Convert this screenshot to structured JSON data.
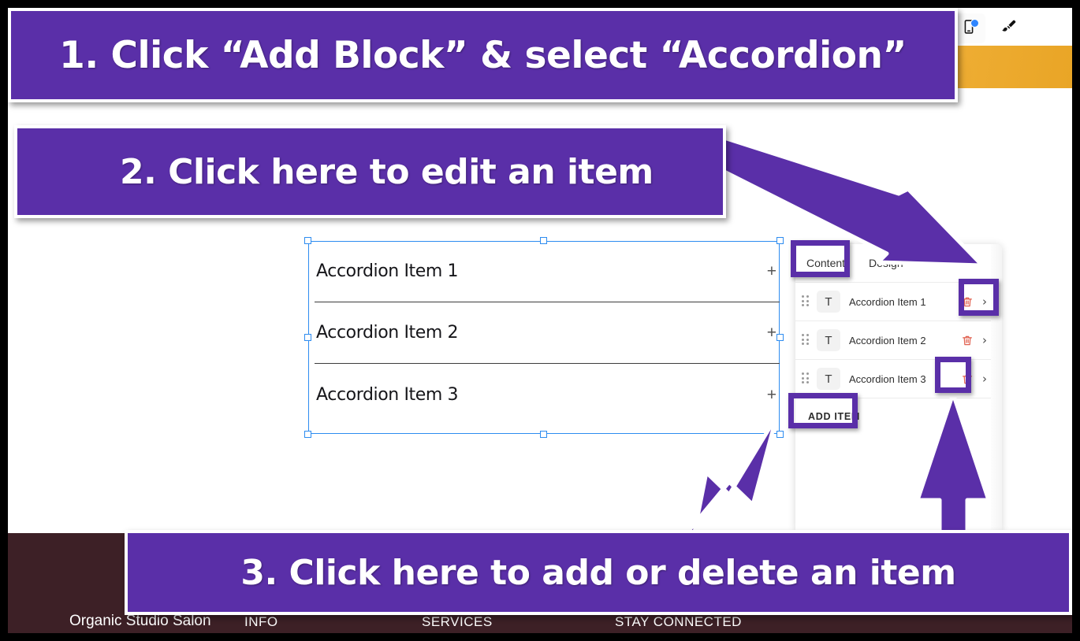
{
  "callouts": [
    {
      "id": "callout-1",
      "text": "1. Click “Add Block” & select “Accordion”"
    },
    {
      "id": "callout-2",
      "text": "2. Click here to edit an item"
    },
    {
      "id": "callout-3",
      "text": "3. Click here to add or delete an item"
    }
  ],
  "toolbar": {
    "desktop_icon": "desktop-monitor-icon",
    "mobile_icon": "mobile-phone-icon",
    "brush_icon": "paint-brush-icon",
    "mobile_badge": "new-indicator-dot"
  },
  "canvas": {
    "accordion_items": [
      {
        "title": "Accordion Item 1",
        "toggle": "+"
      },
      {
        "title": "Accordion Item 2",
        "toggle": "+"
      },
      {
        "title": "Accordion Item 3",
        "toggle": "+"
      }
    ]
  },
  "panel": {
    "tabs": [
      {
        "label": "Content",
        "active": true
      },
      {
        "label": "Design",
        "active": false
      }
    ],
    "rows": [
      {
        "type_icon": "T",
        "label": "Accordion Item 1"
      },
      {
        "type_icon": "T",
        "label": "Accordion Item 2"
      },
      {
        "type_icon": "T",
        "label": "Accordion Item 3"
      }
    ],
    "add_item_label": "ADD ITEM"
  },
  "footer": {
    "brand": "Organic Studio Salon",
    "col_info": "INFO",
    "col_services": "SERVICES",
    "col_social": "STAY CONNECTED"
  },
  "colors": {
    "accent_purple": "#5a2fa8",
    "selection_blue": "#2d8cf0",
    "trash_red": "#e0604f",
    "footer_bg": "#3d2026",
    "hero_orange": "#eda629",
    "frame_black": "#000000"
  }
}
